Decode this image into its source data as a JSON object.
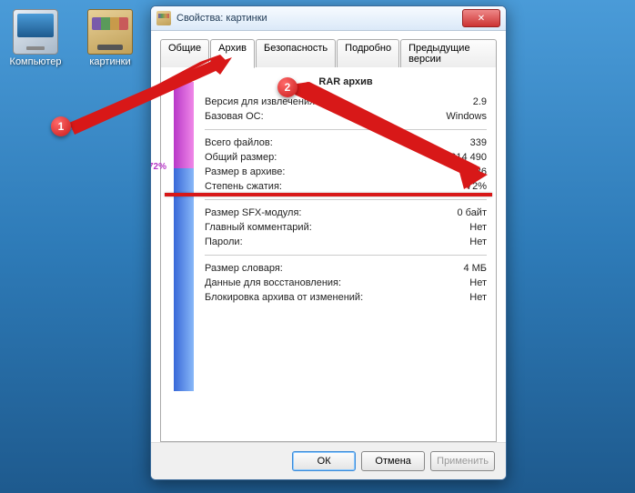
{
  "desktop": {
    "icons": [
      {
        "label": "Компьютер"
      },
      {
        "label": "картинки"
      }
    ]
  },
  "window": {
    "title": "Свойства: картинки"
  },
  "tabs": {
    "general": "Общие",
    "archive": "Архив",
    "security": "Безопасность",
    "details": "Подробно",
    "versions": "Предыдущие версии"
  },
  "archive": {
    "heading": "RAR архив",
    "compression_pct": "72%",
    "rows": {
      "version_label": "Версия для извлечения:",
      "version_value": "2.9",
      "os_label": "Базовая ОС:",
      "os_value": "Windows",
      "files_label": "Всего файлов:",
      "files_value": "339",
      "total_label": "Общий размер:",
      "total_value": "914 490",
      "packed_label": "Размер в архиве:",
      "packed_value": "9 836",
      "ratio_label": "Степень сжатия:",
      "ratio_value": "72%",
      "sfx_label": "Размер SFX-модуля:",
      "sfx_value": "0 байт",
      "comment_label": "Главный комментарий:",
      "comment_value": "Нет",
      "pwd_label": "Пароли:",
      "pwd_value": "Нет",
      "dict_label": "Размер словаря:",
      "dict_value": "4 МБ",
      "recovery_label": "Данные для восстановления:",
      "recovery_value": "Нет",
      "lock_label": "Блокировка архива от изменений:",
      "lock_value": "Нет"
    }
  },
  "buttons": {
    "ok": "ОК",
    "cancel": "Отмена",
    "apply": "Применить"
  },
  "annotations": {
    "badge1": "1",
    "badge2": "2"
  }
}
